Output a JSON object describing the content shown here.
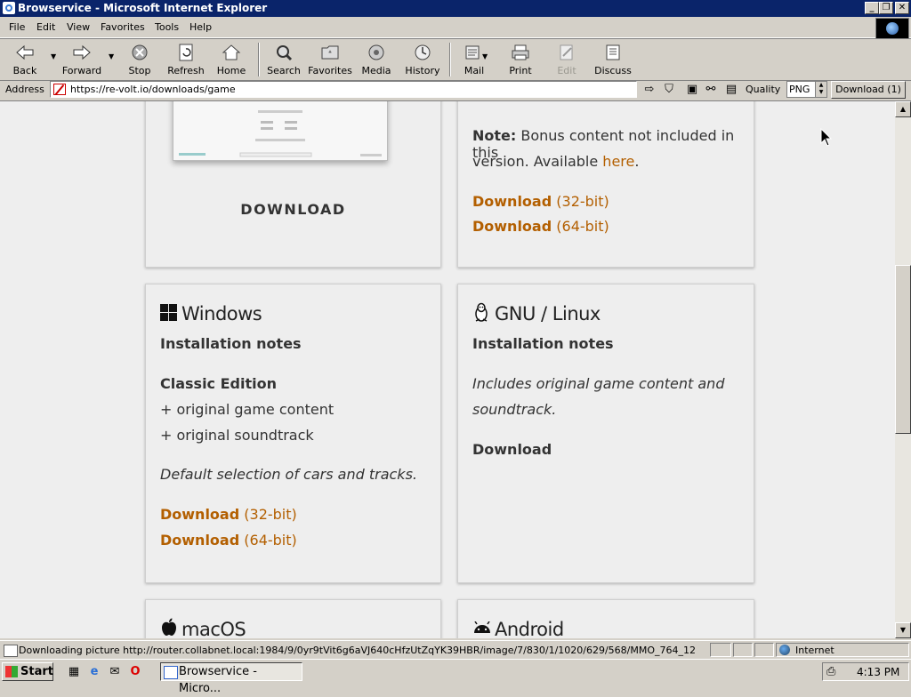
{
  "window": {
    "title": "Browservice - Microsoft Internet Explorer",
    "min": "_",
    "restore": "❐",
    "close": "✕"
  },
  "menu": [
    {
      "label": "File"
    },
    {
      "label": "Edit"
    },
    {
      "label": "View"
    },
    {
      "label": "Favorites"
    },
    {
      "label": "Tools"
    },
    {
      "label": "Help"
    }
  ],
  "toolbar": {
    "back": "Back",
    "forward": "Forward",
    "stop": "Stop",
    "refresh": "Refresh",
    "home": "Home",
    "search": "Search",
    "favorites": "Favorites",
    "media": "Media",
    "history": "History",
    "mail": "Mail",
    "print": "Print",
    "edit": "Edit",
    "discuss": "Discuss"
  },
  "address": {
    "label": "Address",
    "url": "https://re-volt.io/downloads/game",
    "quality_label": "Quality",
    "quality_value": "PNG",
    "download_button": "Download (1)"
  },
  "content": {
    "top_left_card": {
      "download": "DOWNLOAD"
    },
    "top_right_card": {
      "note_label": "Note:",
      "note_text": "Bonus content not included in this",
      "note_text2": "version. Available",
      "note_link": "here",
      "note_period": ".",
      "dl1": "Download",
      "dl1_suffix": "(32-bit)",
      "dl2": "Download",
      "dl2_suffix": "(64-bit)"
    },
    "windows_card": {
      "title": "Windows",
      "install_notes": "Installation notes",
      "edition": "Classic Edition",
      "feature1": "+ original game content",
      "feature2": "+ original soundtrack",
      "description": "Default selection of cars and tracks.",
      "dl1": "Download",
      "dl1_suffix": "(32-bit)",
      "dl2": "Download",
      "dl2_suffix": "(64-bit)"
    },
    "linux_card": {
      "title": "GNU / Linux",
      "install_notes": "Installation notes",
      "description1": "Includes original game content and",
      "description2": "soundtrack.",
      "dl": "Download"
    },
    "macos_card": {
      "title": "macOS"
    },
    "android_card": {
      "title": "Android"
    }
  },
  "status": {
    "text": "Downloading picture http://router.collabnet.local:1984/9/0yr9tVit6g6aVJ640cHfzUtZqYK39HBR/image/7/830/1/1020/629/568/MMO_764_12",
    "zone": "Internet"
  },
  "taskbar": {
    "start": "Start",
    "task": "Browservice - Micro...",
    "clock": "4:13 PM"
  },
  "colors": {
    "accent_link": "#b35f00",
    "titlebar": "#0a246a"
  }
}
